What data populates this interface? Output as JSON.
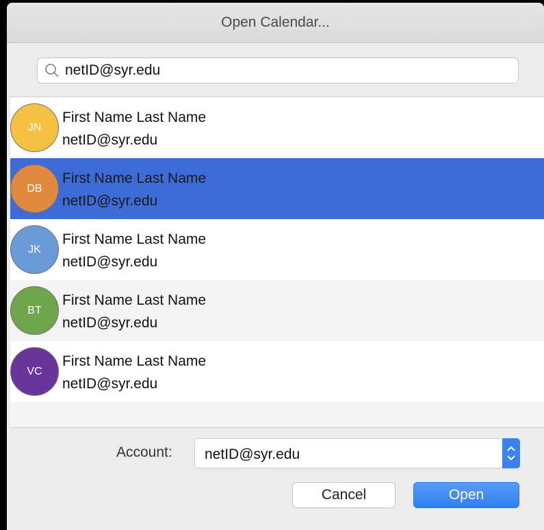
{
  "window": {
    "title": "Open Calendar..."
  },
  "search": {
    "value": "netID@syr.edu"
  },
  "contacts": [
    {
      "initials": "JN",
      "name": "First Name Last Name",
      "email": "netID@syr.edu",
      "avatar_color": "#f5c142",
      "selected": false
    },
    {
      "initials": "DB",
      "name": "First Name Last Name",
      "email": "netID@syr.edu",
      "avatar_color": "#e08a40",
      "selected": true
    },
    {
      "initials": "JK",
      "name": "First Name Last Name",
      "email": "netID@syr.edu",
      "avatar_color": "#6b9bd6",
      "selected": false
    },
    {
      "initials": "BT",
      "name": "First Name Last Name",
      "email": "netID@syr.edu",
      "avatar_color": "#6fa64c",
      "selected": false
    },
    {
      "initials": "VC",
      "name": "First Name Last Name",
      "email": "netID@syr.edu",
      "avatar_color": "#6a3598",
      "selected": false
    }
  ],
  "account": {
    "label": "Account:",
    "value": "netID@syr.edu"
  },
  "buttons": {
    "cancel": "Cancel",
    "open": "Open"
  },
  "colors": {
    "selection": "#3e6bd6",
    "accent": "#3b82f0"
  }
}
